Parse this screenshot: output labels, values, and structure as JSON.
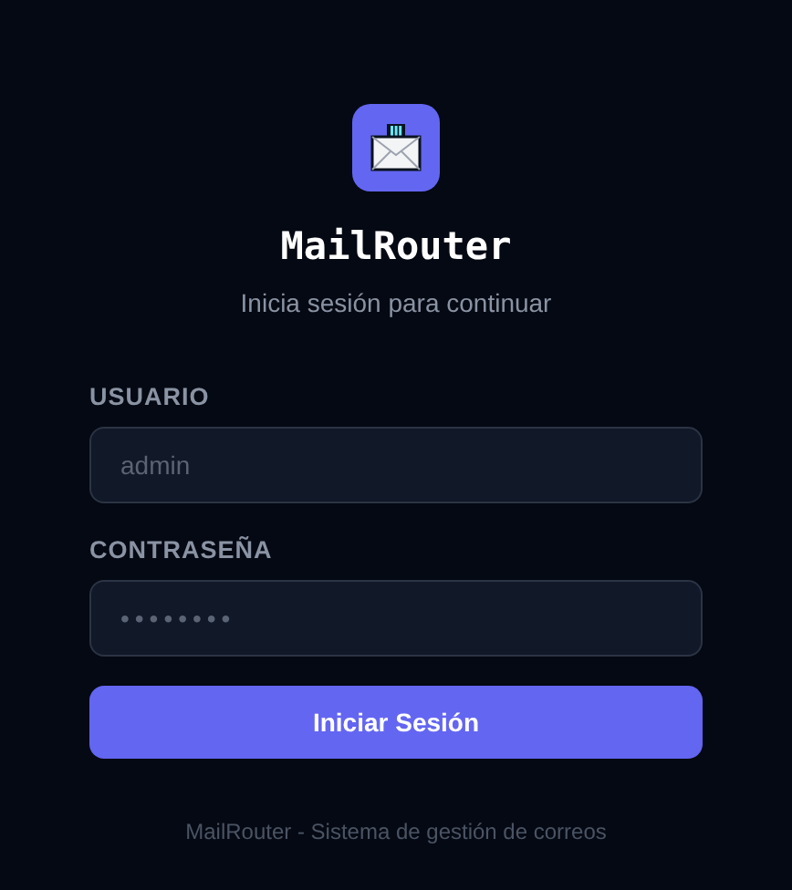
{
  "app": {
    "title": "MailRouter",
    "subtitle": "Inicia sesión para continuar"
  },
  "fields": [
    {
      "label": "USUARIO",
      "placeholder": "admin",
      "kind": "text"
    },
    {
      "label": "CONTRASEÑA",
      "placeholder": "••••••••",
      "kind": "password"
    }
  ],
  "submit": {
    "label": "Iniciar Sesión"
  },
  "footer": "MailRouter - Sistema de gestión de correos"
}
